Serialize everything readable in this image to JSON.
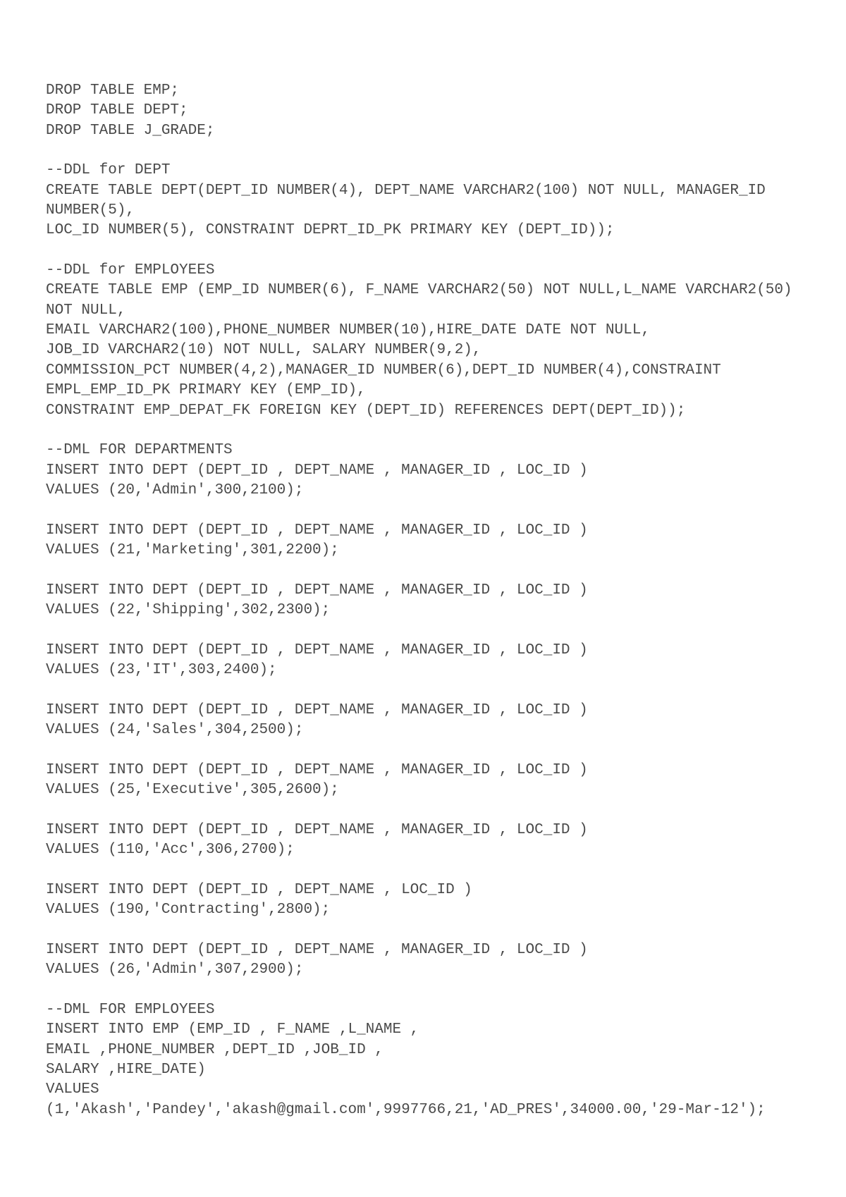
{
  "sql": {
    "text": "DROP TABLE EMP;\nDROP TABLE DEPT;\nDROP TABLE J_GRADE;\n\n--DDL for DEPT\nCREATE TABLE DEPT(DEPT_ID NUMBER(4), DEPT_NAME VARCHAR2(100) NOT NULL, MANAGER_ID NUMBER(5),\nLOC_ID NUMBER(5), CONSTRAINT DEPRT_ID_PK PRIMARY KEY (DEPT_ID));\n\n--DDL for EMPLOYEES\nCREATE TABLE EMP (EMP_ID NUMBER(6), F_NAME VARCHAR2(50) NOT NULL,L_NAME VARCHAR2(50) NOT NULL,\nEMAIL VARCHAR2(100),PHONE_NUMBER NUMBER(10),HIRE_DATE DATE NOT NULL,\nJOB_ID VARCHAR2(10) NOT NULL, SALARY NUMBER(9,2),\nCOMMISSION_PCT NUMBER(4,2),MANAGER_ID NUMBER(6),DEPT_ID NUMBER(4),CONSTRAINT EMPL_EMP_ID_PK PRIMARY KEY (EMP_ID),\nCONSTRAINT EMP_DEPAT_FK FOREIGN KEY (DEPT_ID) REFERENCES DEPT(DEPT_ID));\n\n--DML FOR DEPARTMENTS\nINSERT INTO DEPT (DEPT_ID , DEPT_NAME , MANAGER_ID , LOC_ID )\nVALUES (20,'Admin',300,2100);\n\nINSERT INTO DEPT (DEPT_ID , DEPT_NAME , MANAGER_ID , LOC_ID )\nVALUES (21,'Marketing',301,2200);\n\nINSERT INTO DEPT (DEPT_ID , DEPT_NAME , MANAGER_ID , LOC_ID )\nVALUES (22,'Shipping',302,2300);\n\nINSERT INTO DEPT (DEPT_ID , DEPT_NAME , MANAGER_ID , LOC_ID )\nVALUES (23,'IT',303,2400);\n\nINSERT INTO DEPT (DEPT_ID , DEPT_NAME , MANAGER_ID , LOC_ID )\nVALUES (24,'Sales',304,2500);\n\nINSERT INTO DEPT (DEPT_ID , DEPT_NAME , MANAGER_ID , LOC_ID )\nVALUES (25,'Executive',305,2600);\n\nINSERT INTO DEPT (DEPT_ID , DEPT_NAME , MANAGER_ID , LOC_ID )\nVALUES (110,'Acc',306,2700);\n\nINSERT INTO DEPT (DEPT_ID , DEPT_NAME , LOC_ID )\nVALUES (190,'Contracting',2800);\n\nINSERT INTO DEPT (DEPT_ID , DEPT_NAME , MANAGER_ID , LOC_ID )\nVALUES (26,'Admin',307,2900);\n\n--DML FOR EMPLOYEES\nINSERT INTO EMP (EMP_ID , F_NAME ,L_NAME ,\nEMAIL ,PHONE_NUMBER ,DEPT_ID ,JOB_ID ,\nSALARY ,HIRE_DATE)\nVALUES\n(1,'Akash','Pandey','akash@gmail.com',9997766,21,'AD_PRES',34000.00,'29-Mar-12');"
  }
}
